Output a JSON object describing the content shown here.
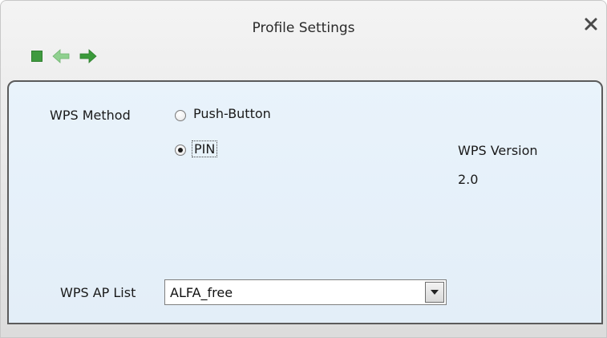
{
  "window": {
    "title": "Profile Settings"
  },
  "toolbar": {
    "icons": [
      "stop-square-icon",
      "back-arrow-icon",
      "forward-arrow-icon"
    ],
    "colors": {
      "stop": "#3f9a3f",
      "back": "#8fd08f",
      "forward": "#3a9a3a"
    }
  },
  "wps": {
    "method_label": "WPS Method",
    "options": [
      {
        "label": "Push-Button",
        "selected": false
      },
      {
        "label": "PIN",
        "selected": true
      }
    ],
    "version_label": "WPS Version",
    "version_value": "2.0",
    "ap_list_label": "WPS AP List",
    "ap_list_selected": "ALFA_free"
  },
  "colors": {
    "panel_bg": "#e6f0f8",
    "panel_border": "#5b5b5b"
  }
}
